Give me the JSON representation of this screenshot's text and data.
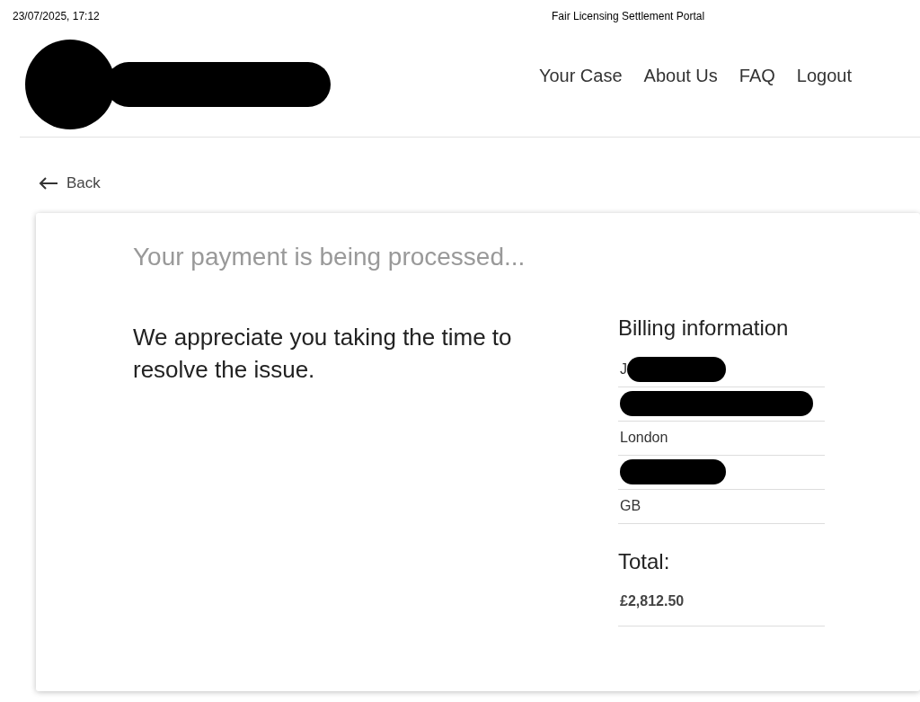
{
  "print_header": {
    "date": "23/07/2025, 17:12",
    "title": "Fair Licensing Settlement Portal"
  },
  "logo": {
    "redacted": true
  },
  "nav": [
    {
      "label": "Your Case"
    },
    {
      "label": "About Us"
    },
    {
      "label": "FAQ"
    },
    {
      "label": "Logout"
    }
  ],
  "back": {
    "label": "Back"
  },
  "heading": "Your payment is being processed...",
  "message": "We appreciate you taking the time to resolve the issue.",
  "billing": {
    "title": "Billing information",
    "rows": [
      {
        "text": "J",
        "redacted": true
      },
      {
        "redacted": true
      },
      {
        "text": "London",
        "redacted": false
      },
      {
        "redacted": true
      },
      {
        "text": "GB",
        "redacted": false
      }
    ]
  },
  "total": {
    "label": "Total:",
    "value": "£2,812.50"
  }
}
